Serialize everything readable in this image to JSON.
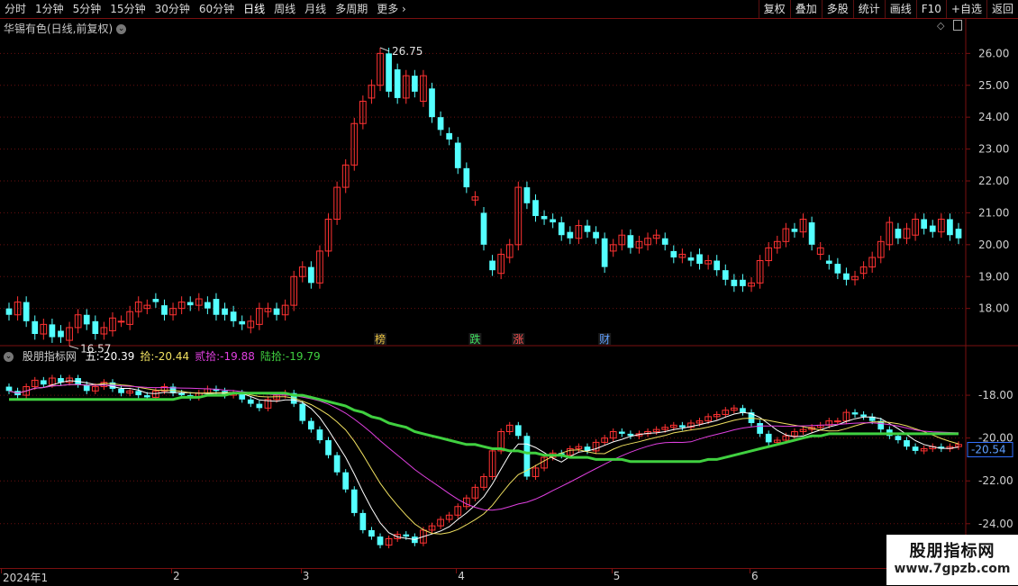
{
  "toolbar": {
    "timeframes": [
      "分时",
      "1分钟",
      "5分钟",
      "15分钟",
      "30分钟",
      "60分钟",
      "日线",
      "周线",
      "月线",
      "多周期",
      "更多"
    ],
    "active": "日线",
    "right_tools": [
      "复权",
      "叠加",
      "多股",
      "统计",
      "画线",
      "F10",
      "+自选",
      "返回"
    ]
  },
  "main_chart": {
    "title": "华锡有色(日线,前复权)",
    "high_label": "26.75",
    "low_label": "16.57",
    "y_ticks": [
      "26.00",
      "25.00",
      "24.00",
      "23.00",
      "22.00",
      "21.00",
      "20.00",
      "19.00",
      "18.00"
    ],
    "y_values": [
      26,
      25,
      24,
      23,
      22,
      21,
      20,
      19,
      18
    ],
    "ylim": [
      17.2,
      26.8
    ],
    "markers": [
      {
        "text": "榜",
        "color": "#e8c040",
        "index": 43
      },
      {
        "text": "跌",
        "color": "#40e060",
        "index": 54
      },
      {
        "text": "涨",
        "color": "#ff5050",
        "index": 59
      },
      {
        "text": "财",
        "color": "#60a0ff",
        "index": 69
      }
    ]
  },
  "indicator": {
    "name": "股朋指标网",
    "series_labels": [
      {
        "label": "五",
        "value": "-20.39",
        "color": "#ffffff"
      },
      {
        "label": "拾",
        "value": "-20.44",
        "color": "#f0e060"
      },
      {
        "label": "贰拾",
        "value": "-19.88",
        "color": "#e040e0"
      },
      {
        "label": "陆拾",
        "value": "-19.79",
        "color": "#40d040"
      }
    ],
    "y_ticks": [
      "-18.00",
      "-20.00",
      "-22.00",
      "-24.00"
    ],
    "y_values": [
      -18,
      -20,
      -22,
      -24
    ],
    "ylim": [
      -25.9,
      -16.4
    ],
    "current_value": "-20.54"
  },
  "date_axis": {
    "labels": [
      {
        "text": "2024年1",
        "index": 0
      },
      {
        "text": "2",
        "index": 19
      },
      {
        "text": "3",
        "index": 34
      },
      {
        "text": "4",
        "index": 52
      },
      {
        "text": "5",
        "index": 70
      },
      {
        "text": "6",
        "index": 86
      }
    ]
  },
  "watermark": {
    "title": "股朋指标网",
    "url": "www.7gpzb.com"
  },
  "colors": {
    "up": "#ff3232",
    "down": "#54ffff",
    "border": "#7a1010",
    "ma60": "#40d040"
  },
  "chart_data": {
    "type": "candlestick",
    "open": [
      18.0,
      17.8,
      18.2,
      17.6,
      17.2,
      17.5,
      17.3,
      17.0,
      17.4,
      17.8,
      17.6,
      17.2,
      17.3,
      17.6,
      17.5,
      17.9,
      18.0,
      18.3,
      18.1,
      17.8,
      18.0,
      18.2,
      18.1,
      18.2,
      18.3,
      18.0,
      17.9,
      17.6,
      17.4,
      17.5,
      17.9,
      18.0,
      17.8,
      18.1,
      19.0,
      19.3,
      18.8,
      19.8,
      20.8,
      21.8,
      22.5,
      23.8,
      24.6,
      25.0,
      26.0,
      25.5,
      24.6,
      25.3,
      24.5,
      24.9,
      24.0,
      23.5,
      23.2,
      22.4,
      21.4,
      21.0,
      19.5,
      19.1,
      19.6,
      20.0,
      21.8,
      21.4,
      20.9,
      20.8,
      20.7,
      20.4,
      20.2,
      20.6,
      20.4,
      20.2,
      19.8,
      20.0,
      20.3,
      19.9,
      20.0,
      20.2,
      20.2,
      19.8,
      19.6,
      19.6,
      19.7,
      19.4,
      19.5,
      19.2,
      18.9,
      18.9,
      18.7,
      18.8,
      19.5,
      19.9,
      20.1,
      20.5,
      20.4,
      20.7,
      19.7,
      19.5,
      19.4,
      19.1,
      18.9,
      19.1,
      19.3,
      19.6,
      20.0,
      20.5,
      20.2,
      20.3,
      20.8,
      20.6,
      20.4,
      20.8,
      20.5
    ],
    "close": [
      17.8,
      18.2,
      17.6,
      17.2,
      17.5,
      17.1,
      17.1,
      17.4,
      17.8,
      17.5,
      17.2,
      17.4,
      17.7,
      17.6,
      17.9,
      18.2,
      18.1,
      18.2,
      17.8,
      18.0,
      18.2,
      18.1,
      18.3,
      18.0,
      17.8,
      17.8,
      17.6,
      17.5,
      17.6,
      18.0,
      18.0,
      17.8,
      18.1,
      19.0,
      19.3,
      18.8,
      19.8,
      20.8,
      21.8,
      22.5,
      23.8,
      24.5,
      25.0,
      26.0,
      24.8,
      24.6,
      25.3,
      24.8,
      25.3,
      24.0,
      23.6,
      23.3,
      22.4,
      21.8,
      21.5,
      20.0,
      19.2,
      19.7,
      20.0,
      21.8,
      21.3,
      20.9,
      20.8,
      20.7,
      20.3,
      20.2,
      20.6,
      20.4,
      20.2,
      19.3,
      20.0,
      20.3,
      19.9,
      20.1,
      20.2,
      20.3,
      20.0,
      19.6,
      19.7,
      19.5,
      19.4,
      19.5,
      19.2,
      18.9,
      18.7,
      18.7,
      18.8,
      19.5,
      19.9,
      20.1,
      20.5,
      20.4,
      20.8,
      20.0,
      19.9,
      19.4,
      19.1,
      18.9,
      19.0,
      19.3,
      19.6,
      20.1,
      20.7,
      20.2,
      20.5,
      20.8,
      20.5,
      20.4,
      20.8,
      20.3,
      20.2
    ],
    "indicator": {
      "bar_values": [
        -17.8,
        -18.0,
        -17.6,
        -17.3,
        -17.5,
        -17.2,
        -17.4,
        -17.2,
        -17.5,
        -17.8,
        -17.6,
        -17.4,
        -17.7,
        -17.9,
        -17.8,
        -18.0,
        -18.1,
        -17.8,
        -17.6,
        -17.9,
        -18.0,
        -18.1,
        -17.9,
        -17.7,
        -17.8,
        -18.0,
        -17.9,
        -18.2,
        -18.4,
        -18.6,
        -18.2,
        -18.0,
        -17.9,
        -18.4,
        -19.2,
        -19.6,
        -20.1,
        -20.8,
        -21.6,
        -22.4,
        -23.5,
        -24.3,
        -24.6,
        -25.0,
        -24.7,
        -24.5,
        -24.6,
        -24.9,
        -24.3,
        -24.1,
        -23.8,
        -23.6,
        -23.2,
        -22.8,
        -22.3,
        -21.8,
        -20.6,
        -19.7,
        -19.4,
        -19.9,
        -21.8,
        -21.4,
        -20.9,
        -20.7,
        -20.8,
        -20.5,
        -20.4,
        -20.6,
        -20.2,
        -20.0,
        -19.7,
        -19.8,
        -19.9,
        -19.8,
        -19.7,
        -19.6,
        -19.5,
        -19.4,
        -19.5,
        -19.3,
        -19.2,
        -19.0,
        -18.9,
        -18.7,
        -18.6,
        -18.8,
        -19.3,
        -19.8,
        -20.2,
        -20.1,
        -19.9,
        -19.7,
        -19.6,
        -19.5,
        -19.4,
        -19.2,
        -19.2,
        -18.8,
        -18.9,
        -19.0,
        -19.2,
        -19.6,
        -19.9,
        -20.1,
        -20.4,
        -20.6,
        -20.5,
        -20.4,
        -20.5,
        -20.4,
        -20.3
      ],
      "ma60": [
        -18.2,
        -18.2,
        -18.2,
        -18.2,
        -18.2,
        -18.2,
        -18.2,
        -18.2,
        -18.2,
        -18.2,
        -18.2,
        -18.2,
        -18.2,
        -18.2,
        -18.2,
        -18.2,
        -18.2,
        -18.2,
        -18.2,
        -18.2,
        -18.1,
        -18.1,
        -18.1,
        -18.0,
        -18.0,
        -18.0,
        -17.9,
        -17.9,
        -17.9,
        -17.9,
        -17.9,
        -17.9,
        -17.9,
        -18.0,
        -18.0,
        -18.1,
        -18.2,
        -18.3,
        -18.4,
        -18.5,
        -18.7,
        -18.8,
        -19.0,
        -19.1,
        -19.3,
        -19.4,
        -19.5,
        -19.7,
        -19.8,
        -19.9,
        -20.0,
        -20.1,
        -20.2,
        -20.3,
        -20.3,
        -20.4,
        -20.5,
        -20.5,
        -20.6,
        -20.6,
        -20.7,
        -20.7,
        -20.8,
        -20.8,
        -20.8,
        -20.9,
        -20.9,
        -20.9,
        -21.0,
        -21.0,
        -21.0,
        -21.0,
        -21.1,
        -21.1,
        -21.1,
        -21.1,
        -21.1,
        -21.1,
        -21.1,
        -21.1,
        -21.1,
        -21.0,
        -21.0,
        -20.9,
        -20.8,
        -20.7,
        -20.6,
        -20.5,
        -20.4,
        -20.3,
        -20.2,
        -20.1,
        -20.0,
        -19.9,
        -19.9,
        -19.8,
        -19.8,
        -19.8,
        -19.8,
        -19.8,
        -19.8,
        -19.8,
        -19.8,
        -19.8,
        -19.8,
        -19.8,
        -19.8,
        -19.8,
        -19.8,
        -19.8,
        -19.8
      ]
    }
  }
}
